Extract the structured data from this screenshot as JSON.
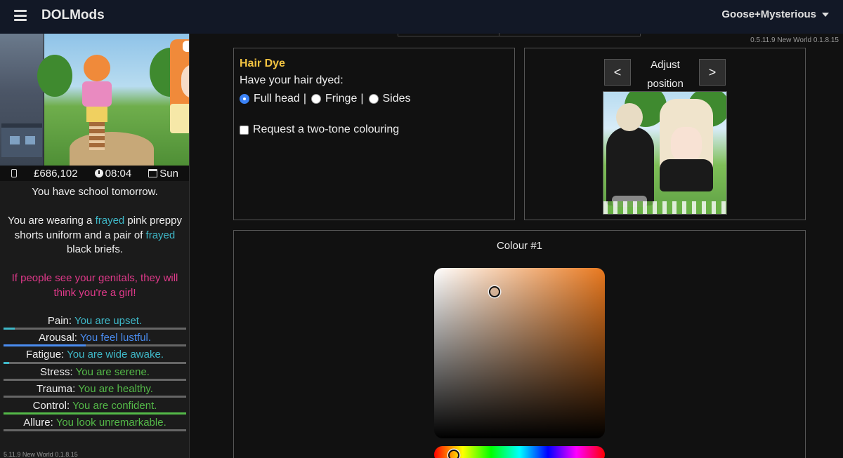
{
  "topbar": {
    "brand": "DOLMods",
    "user": "Goose+Mysterious"
  },
  "version": "0.5.11.9 New World 0.1.8.15",
  "sidebar": {
    "status": {
      "money": "£686,102",
      "time": "08:04",
      "day": "Sun"
    },
    "narrative": {
      "line1": "You have school tomorrow.",
      "wear_1": "You are wearing a ",
      "frayed_1": "frayed",
      "wear_2": " pink preppy shorts uniform and a pair of ",
      "frayed_2": "frayed",
      "wear_3": " black briefs.",
      "warning": "If people see your genitals, they will think you're a girl!"
    },
    "stats": [
      {
        "label": "Pain:",
        "value": "You are upset.",
        "level": 0.06,
        "color": "#3fb8c8"
      },
      {
        "label": "Arousal:",
        "value": "You feel lustful.",
        "level": 0.45,
        "color": "#4a8cf0"
      },
      {
        "label": "Fatigue:",
        "value": "You are wide awake.",
        "level": 0.03,
        "color": "#3fb8c8"
      },
      {
        "label": "Stress:",
        "value": "You are serene.",
        "level": 0.0,
        "color": "#54b948"
      },
      {
        "label": "Trauma:",
        "value": "You are healthy.",
        "level": 0.0,
        "color": "#54b948"
      },
      {
        "label": "Control:",
        "value": "You are confident.",
        "level": 1.0,
        "color": "#54b948"
      },
      {
        "label": "Allure:",
        "value": "You look unremarkable.",
        "level": 0.0,
        "color": "#54b948"
      }
    ],
    "version": "5.11.9 New World 0.1.8.15"
  },
  "hair_dye": {
    "title": "Hair Dye",
    "question": "Have your hair dyed:",
    "options": [
      "Full head",
      "Fringe",
      "Sides"
    ],
    "separator": "|",
    "selected": "Full head",
    "two_tone_label": "Request a two-tone colouring",
    "two_tone_checked": false
  },
  "preview": {
    "prev_label": "<",
    "next_label": ">",
    "adjust_label": "Adjust position"
  },
  "colour": {
    "title": "Colour #1",
    "hue_color": "#e8781e"
  }
}
